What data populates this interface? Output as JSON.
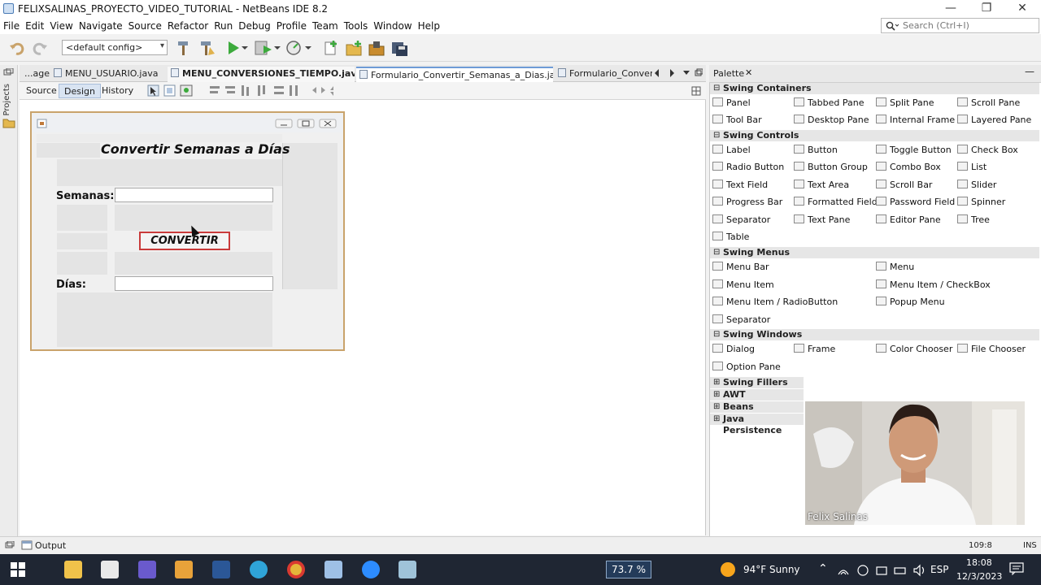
{
  "window": {
    "title": "FELIXSALINAS_PROYECTO_VIDEO_TUTORIAL - NetBeans IDE 8.2",
    "minimize_glyph": "—",
    "maximize_glyph": "❐",
    "close_glyph": "✕"
  },
  "menu": [
    "File",
    "Edit",
    "View",
    "Navigate",
    "Source",
    "Refactor",
    "Run",
    "Debug",
    "Profile",
    "Team",
    "Tools",
    "Window",
    "Help"
  ],
  "search": {
    "placeholder": "Search (Ctrl+I)"
  },
  "toolbar": {
    "config_value": "<default config>"
  },
  "left_strip": {
    "projects_label": "Projects"
  },
  "editor_tabs": [
    {
      "label": "...age"
    },
    {
      "label": "MENU_USUARIO.java"
    },
    {
      "label": "MENU_CONVERSIONES_TIEMPO.java"
    },
    {
      "label": "Formulario_Convertir_Semanas_a_Dias.java"
    },
    {
      "label": "Formulario_Convert..."
    }
  ],
  "view_tabs": {
    "source": "Source",
    "design": "Design",
    "history": "History"
  },
  "form": {
    "heading": "Convertir Semanas a Días",
    "semanas_label": "Semanas:",
    "dias_label": "Días:",
    "button_label": "CONVERTIR",
    "semanas_value": "",
    "dias_value": ""
  },
  "palette": {
    "title": "Palette",
    "categories": {
      "swing_containers": "Swing Containers",
      "swing_controls": "Swing Controls",
      "swing_menus": "Swing Menus",
      "swing_windows": "Swing Windows",
      "swing_fillers": "Swing Fillers",
      "awt": "AWT",
      "beans": "Beans",
      "java_persistence": "Java Persistence"
    },
    "containers": [
      "Panel",
      "Tabbed Pane",
      "Split Pane",
      "Scroll Pane",
      "Tool Bar",
      "Desktop Pane",
      "Internal Frame",
      "Layered Pane"
    ],
    "controls": [
      "Label",
      "Button",
      "Toggle Button",
      "Check Box",
      "Radio Button",
      "Button Group",
      "Combo Box",
      "List",
      "Text Field",
      "Text Area",
      "Scroll Bar",
      "Slider",
      "Progress Bar",
      "Formatted Field",
      "Password Field",
      "Spinner",
      "Separator",
      "Text Pane",
      "Editor Pane",
      "Tree",
      "Table"
    ],
    "menus": [
      "Menu Bar",
      "Menu",
      "Menu Item",
      "Menu Item / CheckBox",
      "Menu Item / RadioButton",
      "Popup Menu",
      "Separator"
    ],
    "windows": [
      "Dialog",
      "Frame",
      "Color Chooser",
      "File Chooser",
      "Option Pane"
    ]
  },
  "webcam": {
    "name": "Felix Salinas"
  },
  "status": {
    "output_label": "Output",
    "position": "109:8",
    "mode": "INS"
  },
  "taskbar": {
    "zoom": "73.7 %",
    "weather": "94°F  Sunny",
    "lang": "ESP",
    "time": "18:08",
    "date": "12/3/2023"
  },
  "colors": {
    "accent": "#c93a3a",
    "frame_border": "#c9a36b",
    "taskbar": "#1f2633"
  }
}
